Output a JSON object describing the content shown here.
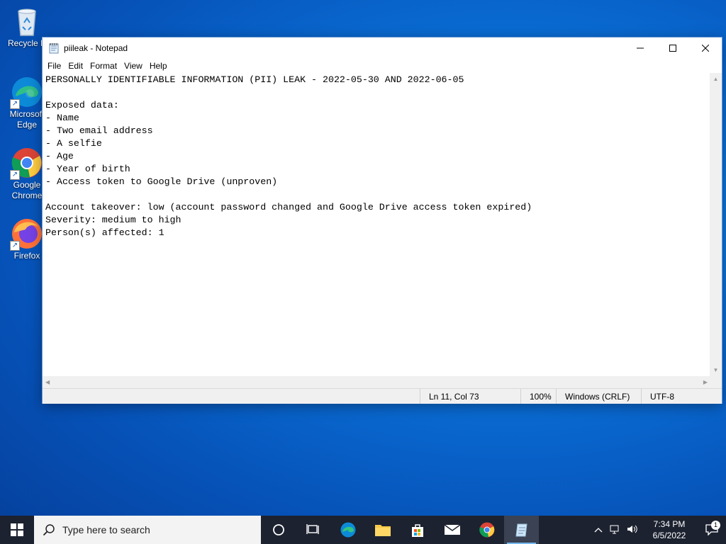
{
  "desktop": {
    "icons": [
      {
        "label": "Recycle Bin",
        "display": "Recycle B"
      },
      {
        "label": "Microsoft Edge",
        "display": "Microsoft Edge"
      },
      {
        "label": "Google Chrome",
        "display": "Google Chrome"
      },
      {
        "label": "Firefox",
        "display": "Firefox"
      }
    ]
  },
  "window": {
    "title": "piileak - Notepad",
    "menu": [
      "File",
      "Edit",
      "Format",
      "View",
      "Help"
    ],
    "content": "PERSONALLY IDENTIFIABLE INFORMATION (PII) LEAK - 2022-05-30 AND 2022-06-05\n\nExposed data:\n- Name\n- Two email address\n- A selfie\n- Age\n- Year of birth\n- Access token to Google Drive (unproven)\n\nAccount takeover: low (account password changed and Google Drive access token expired)\nSeverity: medium to high\nPerson(s) affected: 1",
    "status": {
      "position": "Ln 11, Col 73",
      "zoom": "100%",
      "line_ending": "Windows (CRLF)",
      "encoding": "UTF-8"
    }
  },
  "taskbar": {
    "search_placeholder": "Type here to search",
    "pinned": [
      "task-view",
      "edge",
      "file-explorer",
      "store",
      "mail",
      "chrome",
      "notepad"
    ],
    "time": "7:34 PM",
    "date": "6/5/2022",
    "notification_count": "1"
  },
  "colors": {
    "desktop_blue": "#0a6fd6",
    "taskbar": "#1c2230",
    "accent": "#76b9ed"
  }
}
